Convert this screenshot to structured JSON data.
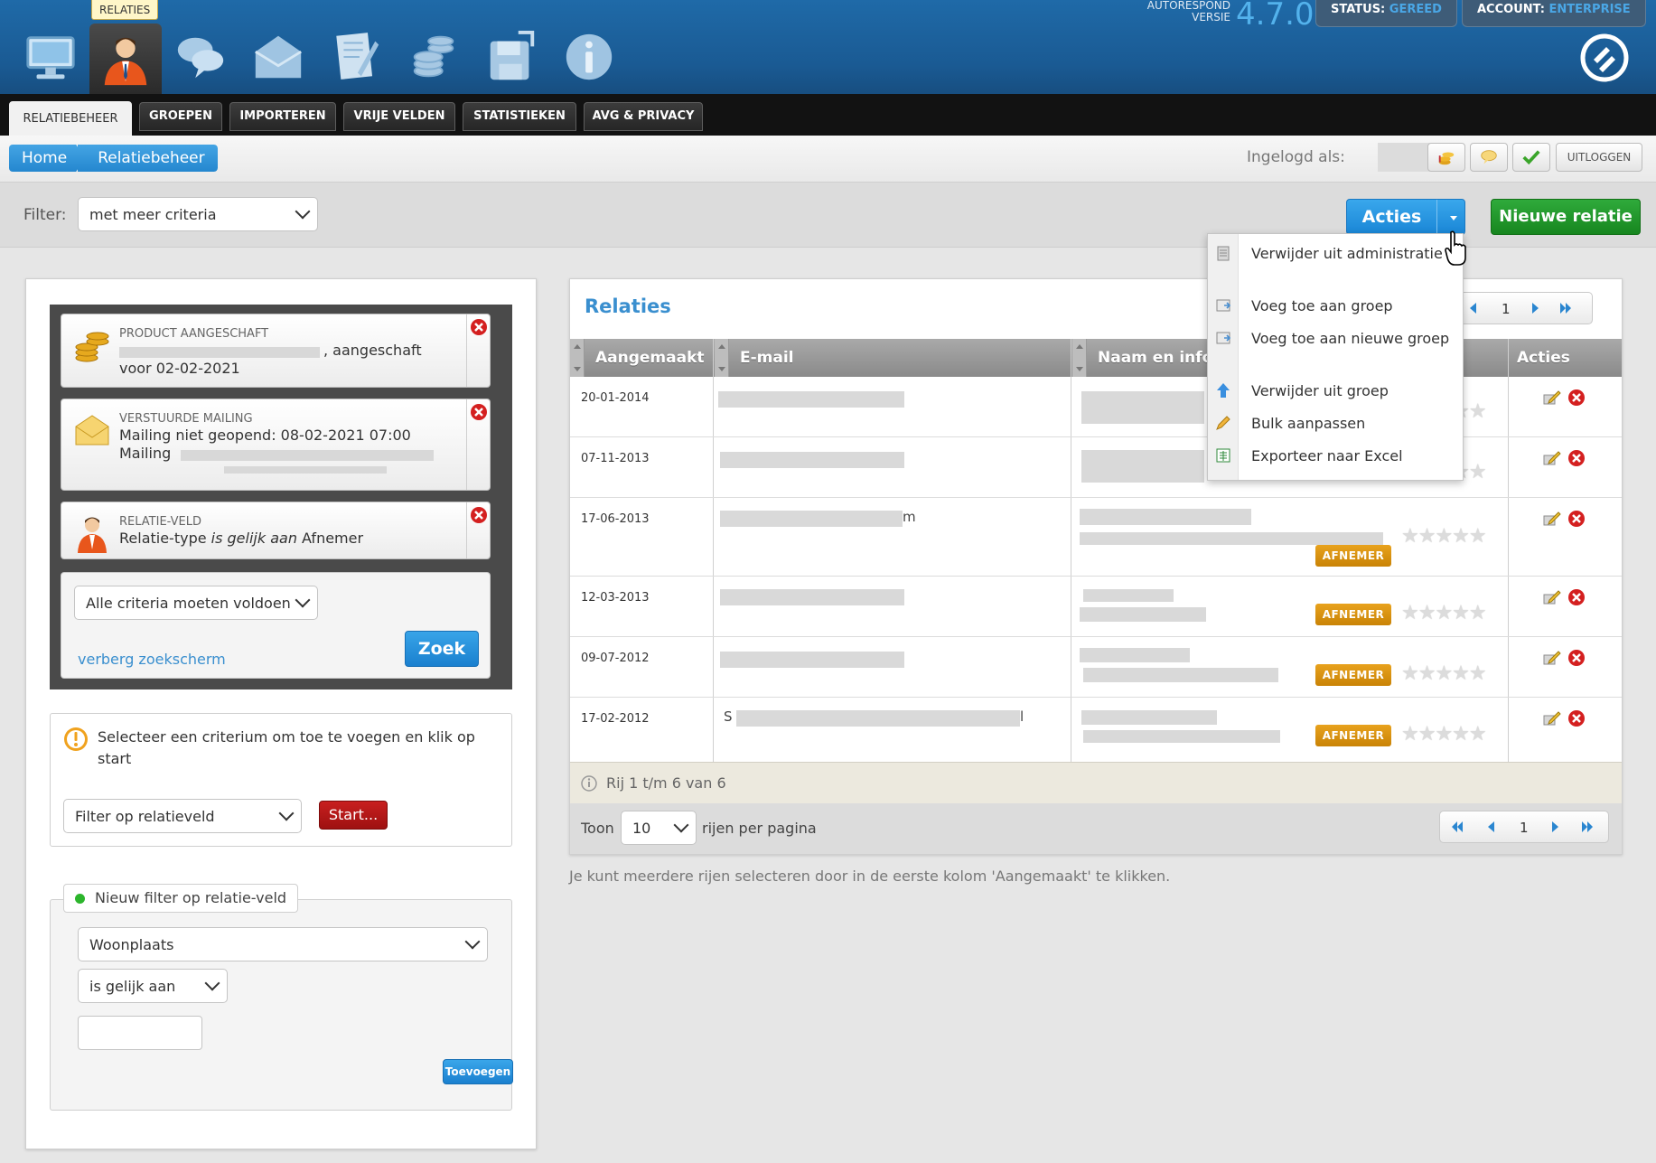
{
  "header": {
    "active_icon_tooltip": "RELATIES",
    "version_label_line1": "AUTORESPOND",
    "version_label_line2": "VERSIE",
    "version_number": "4.7.0",
    "status_label": "STATUS:",
    "status_value": "GEREED",
    "account_label": "ACCOUNT:",
    "account_value": "ENTERPRISE",
    "icons": [
      "monitor-icon",
      "relaties-user-icon",
      "chat-bubbles-icon",
      "envelope-icon",
      "document-pen-icon",
      "coins-icon",
      "floppy-icon",
      "info-icon"
    ]
  },
  "tabs": [
    {
      "label": "RELATIEBEHEER",
      "active": true
    },
    {
      "label": "GROEPEN"
    },
    {
      "label": "IMPORTEREN"
    },
    {
      "label": "VRIJE VELDEN"
    },
    {
      "label": "STATISTIEKEN"
    },
    {
      "label": "AVG & PRIVACY"
    }
  ],
  "breadcrumb": {
    "home": "Home",
    "current": "Relatiebeheer"
  },
  "session": {
    "logged_in_label": "Ingelogd als:",
    "logout_label": "UITLOGGEN"
  },
  "filterbar": {
    "filter_label": "Filter:",
    "filter_value": "met meer criteria",
    "acties_label": "Acties",
    "new_relatie_label": "Nieuwe relatie"
  },
  "acties_menu": [
    {
      "icon": "trash-list-icon",
      "label": "Verwijder uit administratie"
    },
    {
      "icon": "add-group-icon",
      "label": "Voeg toe aan groep"
    },
    {
      "icon": "add-new-group-icon",
      "label": "Voeg toe aan nieuwe groep"
    },
    {
      "icon": "arrow-up-icon",
      "label": "Verwijder uit groep"
    },
    {
      "icon": "pencil-icon",
      "label": "Bulk aanpassen"
    },
    {
      "icon": "excel-icon",
      "label": "Exporteer naar Excel"
    }
  ],
  "criteria": [
    {
      "kind": "PRODUCT AANGESCHAFT",
      "line1_suffix": ", aangeschaft",
      "line2": "voor 02-02-2021"
    },
    {
      "kind": "VERSTUURDE MAILING",
      "line1": "Mailing niet geopend: 08-02-2021 07:00",
      "line2": "Mailing"
    },
    {
      "kind": "RELATIE-VELD",
      "line1_a": "Relatie-type ",
      "line1_b": "is gelijk aan",
      "line1_c": " Afnemer"
    }
  ],
  "search": {
    "match_value": "Alle criteria moeten voldoen",
    "zoek_label": "Zoek",
    "hide_link": "verberg zoekscherm"
  },
  "hint": {
    "text": "Selecteer een criterium om toe te voegen en klik op start",
    "select_value": "Filter op relatieveld",
    "start_label": "Start..."
  },
  "new_filter": {
    "legend": "Nieuw filter op relatie-veld",
    "field_value": "Woonplaats",
    "operator_value": "is gelijk aan",
    "add_label": "Toevoegen"
  },
  "relaties": {
    "title": "Relaties",
    "page": "1",
    "columns": {
      "created": "Aangemaakt",
      "email": "E-mail",
      "name": "Naam en info",
      "actions": "Acties"
    },
    "rows": [
      {
        "created": "20-01-2014",
        "badge": ""
      },
      {
        "created": "07-11-2013",
        "badge": ""
      },
      {
        "created": "17-06-2013",
        "email_fragment": "m",
        "badge": "AFNEMER"
      },
      {
        "created": "12-03-2013",
        "badge": "AFNEMER"
      },
      {
        "created": "09-07-2012",
        "badge": "AFNEMER"
      },
      {
        "created": "17-02-2012",
        "email_fragment": "S",
        "email_fragment_end": "l",
        "badge": "AFNEMER"
      }
    ],
    "info": "Rij 1 t/m 6 van 6",
    "show_label": "Toon",
    "per_page_value": "10",
    "per_page_suffix": "rijen per pagina",
    "hint": "Je kunt meerdere rijen selecteren door in de eerste kolom 'Aangemaakt' te klikken."
  },
  "colors": {
    "brand_blue": "#1a5a93",
    "accent_blue": "#3a8fcf",
    "green": "#17861f",
    "red": "#9e1111",
    "badge": "#d9920f"
  }
}
